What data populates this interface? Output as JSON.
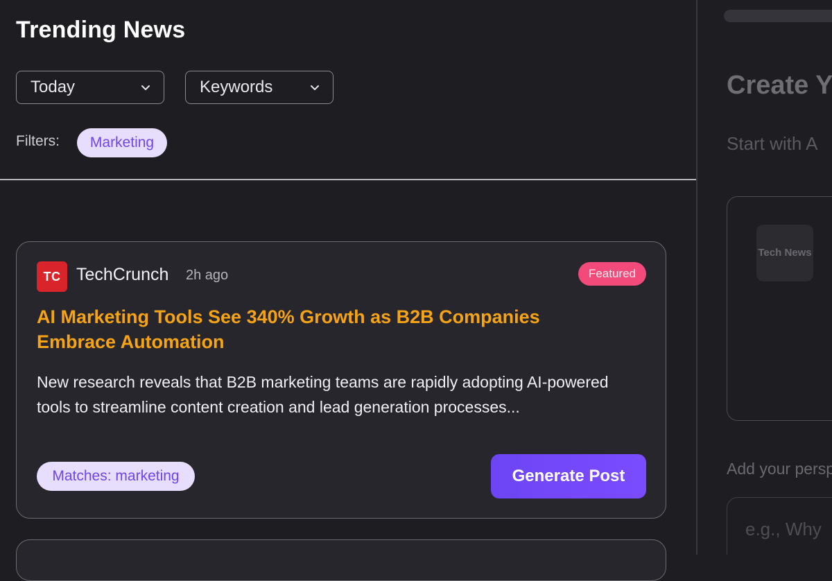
{
  "header": {
    "title": "Trending News"
  },
  "filters": {
    "time_dropdown": "Today",
    "keywords_dropdown": "Keywords",
    "filters_label": "Filters:",
    "active_chip": "Marketing"
  },
  "article": {
    "source_logo_text": "TC",
    "source_name": "TechCrunch",
    "time_ago": "2h ago",
    "badge": "Featured",
    "headline": "AI Marketing Tools See 340% Growth as B2B Companies Embrace Automation",
    "summary": "New research reveals that B2B marketing teams are rapidly adopting AI-powered tools to streamline content creation and lead generation processes...",
    "match_chip": "Matches: marketing",
    "generate_button": "Generate Post"
  },
  "right_panel": {
    "title": "Create Y",
    "subtitle": "Start with A",
    "logo_text": "Tech News",
    "perspective_label": "Add your persp",
    "input_placeholder": "e.g., Why"
  },
  "colors": {
    "background": "#1e1d22",
    "card": "#27262c",
    "headline": "#f6a416",
    "accent": "#6d45f5",
    "chip_bg": "#e7defe",
    "chip_text": "#6f45f0",
    "badge": "#f24a7a",
    "source_logo": "#d9242b"
  },
  "icons": {
    "dropdown": "chevron-down-icon"
  }
}
